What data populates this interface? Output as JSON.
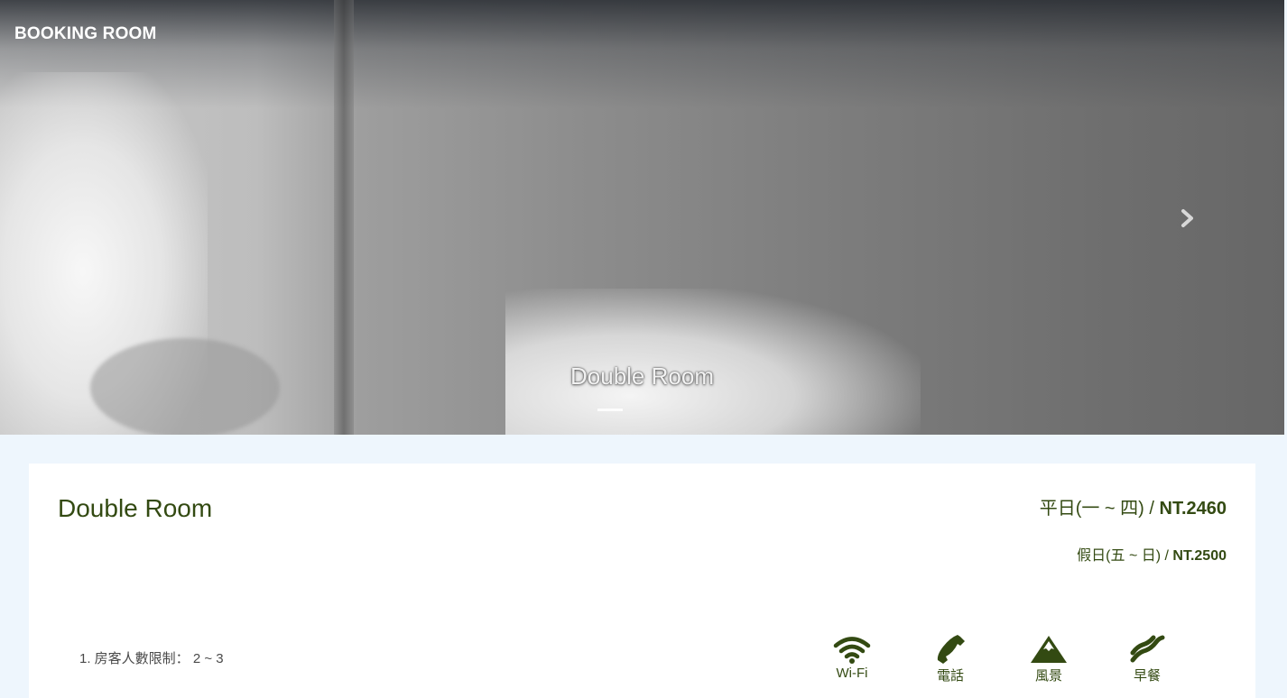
{
  "navbar": {
    "brand": "BOOKING ROOM"
  },
  "carousel": {
    "caption": "Double Room",
    "next_icon": "chevron-right-icon"
  },
  "room": {
    "title": "Double Room",
    "weekday_label": "平日(一 ~ 四) / ",
    "weekday_price": "NT.2460",
    "weekend_label": "假日(五 ~ 日) / ",
    "weekend_price": "NT.2500",
    "rules": [
      "1. 房客人數限制： 2 ~ 3"
    ]
  },
  "amenities": [
    {
      "label": "Wi-Fi",
      "icon": "wifi-icon"
    },
    {
      "label": "電話",
      "icon": "phone-icon"
    },
    {
      "label": "風景",
      "icon": "mountain-icon"
    },
    {
      "label": "早餐",
      "icon": "breakfast-icon"
    }
  ],
  "colors": {
    "accent": "#334a12",
    "page_bg": "#eef6fd",
    "card_bg": "#ffffff"
  }
}
